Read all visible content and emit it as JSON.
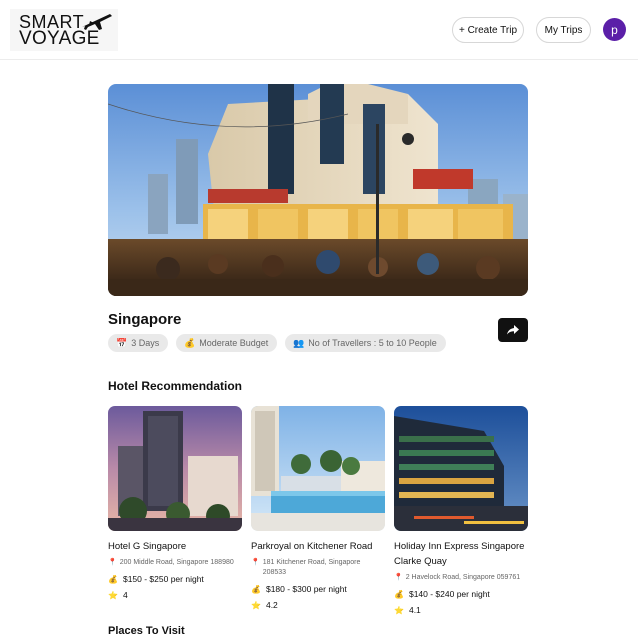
{
  "header": {
    "logo_line1": "SMART",
    "logo_line2": "VOYAGE",
    "create_trip_label": "+ Create Trip",
    "my_trips_label": "My Trips",
    "avatar_initial": "p"
  },
  "trip": {
    "destination": "Singapore",
    "days_label": "3 Days",
    "budget_label": "Moderate Budget",
    "travellers_label": "No of Travellers : 5 to 10 People"
  },
  "sections": {
    "hotels_title": "Hotel Recommendation",
    "places_title": "Places To Visit"
  },
  "hotels": [
    {
      "name": "Hotel G Singapore",
      "address": "200 Middle Road, Singapore 188980",
      "price": "$150 - $250 per night",
      "rating": "4"
    },
    {
      "name": "Parkroyal on Kitchener Road",
      "address": "181 Kitchener Road, Singapore 208533",
      "price": "$180 - $300 per night",
      "rating": "4.2"
    },
    {
      "name": "Holiday Inn Express Singapore Clarke Quay",
      "address": "2 Havelock Road, Singapore 059761",
      "price": "$140 - $240 per night",
      "rating": "4.1"
    }
  ],
  "icons": {
    "calendar": "calendar-icon",
    "budget": "money-bag-icon",
    "travellers": "people-icon",
    "share": "share-icon",
    "pin": "map-pin-icon",
    "price": "money-bag-icon",
    "rating": "star-icon"
  },
  "colors": {
    "avatar": "#5b1fa8",
    "share_button": "#111111",
    "chip_bg": "#e9e9e9",
    "pin": "#e33a6b",
    "star": "#f5b800"
  }
}
